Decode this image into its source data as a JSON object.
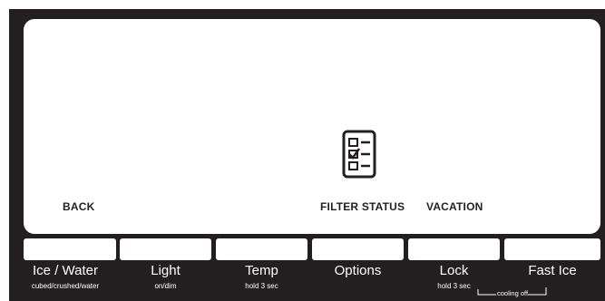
{
  "screen": {
    "back_label": "BACK",
    "filter_status_label": "FILTER STATUS",
    "vacation_label": "VACATION",
    "filter_icon": "checklist-icon"
  },
  "buttons": [
    {
      "label": "Ice / Water",
      "sub": "cubed/crushed/water"
    },
    {
      "label": "Light",
      "sub": "on/dim"
    },
    {
      "label": "Temp",
      "sub": "hold 3 sec"
    },
    {
      "label": "Options",
      "sub": ""
    },
    {
      "label": "Lock",
      "sub": "hold 3 sec"
    },
    {
      "label": "Fast Ice",
      "sub": ""
    }
  ],
  "cooling_off_label": "cooling off",
  "colors": {
    "panel": "#231f20",
    "screen": "#ffffff",
    "text_light": "#ffffff"
  }
}
